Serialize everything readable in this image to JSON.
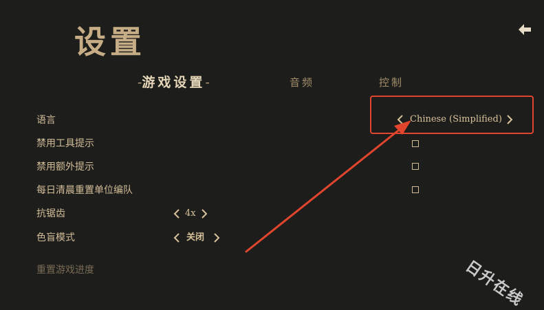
{
  "header": {
    "title": "设置"
  },
  "tabs": [
    {
      "label": "游戏设置",
      "active": true
    },
    {
      "label": "音频",
      "active": false
    },
    {
      "label": "控制",
      "active": false
    }
  ],
  "tab_dash": "-",
  "settings": {
    "language": {
      "label": "语言",
      "value": "Chinese (Simplified)"
    },
    "disable_tool_tips": {
      "label": "禁用工具提示",
      "checked": false
    },
    "disable_extra_tips": {
      "label": "禁用额外提示",
      "checked": false
    },
    "daily_reset_squads": {
      "label": "每日清晨重置单位编队",
      "checked": false
    },
    "antialiasing": {
      "label": "抗锯齿",
      "value": "4x"
    },
    "colorblind_mode": {
      "label": "色盲模式",
      "value": "关闭"
    }
  },
  "reset_progress": {
    "label": "重置游戏进度"
  },
  "watermark": {
    "text": "日升在线"
  },
  "colors": {
    "background": "#1d1d1b",
    "text": "#d2bd98",
    "title": "#c6ad85",
    "highlight": "#e2452e"
  },
  "icons": {
    "back": "back-arrow-icon",
    "prev": "chevron-left-icon",
    "next": "chevron-right-icon"
  }
}
